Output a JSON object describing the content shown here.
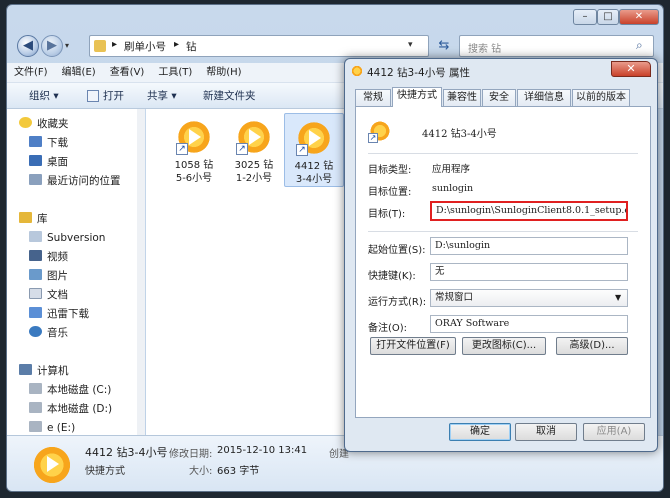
{
  "explorer": {
    "breadcrumb": [
      "刷单小号",
      "钻"
    ],
    "search_placeholder": "搜索 钻",
    "menu": [
      "文件(F)",
      "编辑(E)",
      "查看(V)",
      "工具(T)",
      "帮助(H)"
    ],
    "toolbar": {
      "organize": "组织 ▾",
      "open": "打开",
      "share": "共享 ▾",
      "new_folder": "新建文件夹"
    },
    "nav": {
      "favorites": "收藏夹",
      "fav_items": [
        "下载",
        "桌面",
        "最近访问的位置"
      ],
      "library": "库",
      "lib_items": [
        "Subversion",
        "视频",
        "图片",
        "文档",
        "迅雷下载",
        "音乐"
      ],
      "computer": "计算机",
      "drives": [
        "本地磁盘 (C:)",
        "本地磁盘 (D:)",
        "e (E:)"
      ]
    },
    "files": [
      {
        "line1": "1058 钻",
        "line2": "5-6小号"
      },
      {
        "line1": "3025 钻",
        "line2": "1-2小号"
      },
      {
        "line1": "4412 钻",
        "line2": "3-4小号"
      }
    ],
    "details": {
      "name": "4412 钻3-4小号",
      "type": "快捷方式",
      "modified_label": "修改日期:",
      "modified": "2015-12-10 13:41",
      "size_label": "大小:",
      "size": "663 字节",
      "created_label": "创建"
    }
  },
  "dialog": {
    "title": "4412 钻3-4小号 属性",
    "tabs": [
      "常规",
      "快捷方式",
      "兼容性",
      "安全",
      "详细信息",
      "以前的版本"
    ],
    "name": "4412 钻3-4小号",
    "target_type_label": "目标类型:",
    "target_type": "应用程序",
    "target_location_label": "目标位置:",
    "target_location": "sunlogin",
    "target_label": "目标(T):",
    "target": "D:\\sunlogin\\SunloginClient8.0.1_setup.e",
    "start_in_label": "起始位置(S):",
    "start_in": "D:\\sunlogin",
    "hotkey_label": "快捷键(K):",
    "hotkey": "无",
    "run_label": "运行方式(R):",
    "run": "常规窗口",
    "comment_label": "备注(O):",
    "comment": "ORAY Software",
    "open_location": "打开文件位置(F)",
    "change_icon": "更改图标(C)...",
    "advanced": "高级(D)...",
    "ok": "确定",
    "cancel": "取消",
    "apply": "应用(A)",
    "highlight_color": "#e02020"
  }
}
